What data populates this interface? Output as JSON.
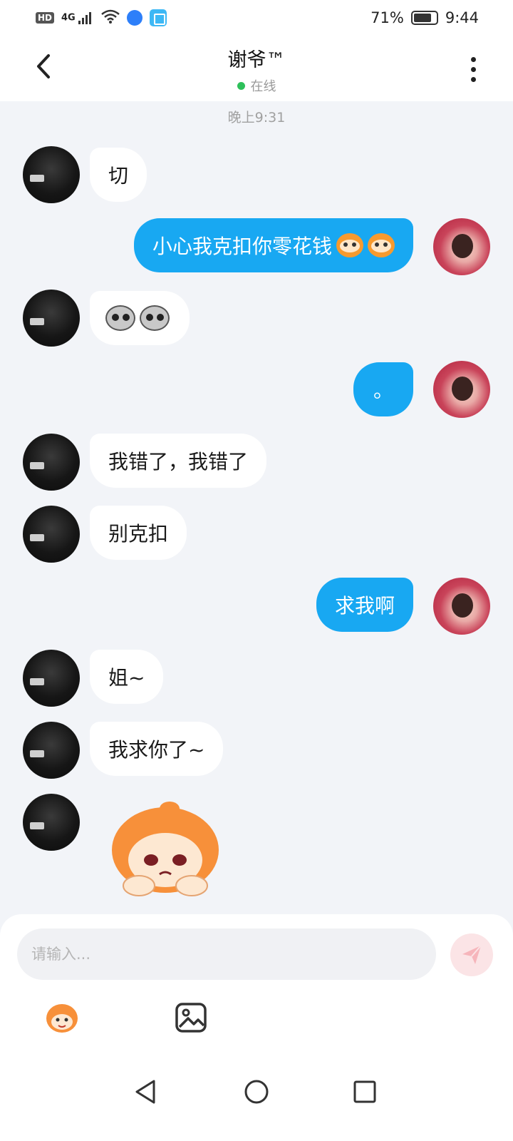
{
  "status_bar": {
    "hd": "HD",
    "network": "4G",
    "battery_percent": "71%",
    "time": "9:44",
    "icons": [
      "hd-icon",
      "signal-icon",
      "wifi-icon",
      "browser-app-icon",
      "reader-app-icon",
      "battery-icon"
    ]
  },
  "header": {
    "title": "谢爷™",
    "presence": "在线",
    "presence_color": "#2ec05a",
    "back_icon": "chevron-left-icon",
    "more_icon": "more-vertical-icon"
  },
  "chat": {
    "timestamp": "晚上9:31",
    "messages": [
      {
        "side": "in",
        "text": "切"
      },
      {
        "side": "out",
        "text": "小心我克扣你零花钱",
        "emojis": [
          "monkey-emoji",
          "monkey-emoji"
        ]
      },
      {
        "side": "in",
        "text": "",
        "emojis": [
          "gray-face-emoji",
          "gray-face-emoji"
        ]
      },
      {
        "side": "out",
        "text": "。"
      },
      {
        "side": "in",
        "text": "我错了，我错了"
      },
      {
        "side": "in",
        "text": "别克扣"
      },
      {
        "side": "out",
        "text": "求我啊"
      },
      {
        "side": "in",
        "text": "姐~"
      },
      {
        "side": "in",
        "text": "我求你了~"
      },
      {
        "side": "in",
        "sticker": "sad-monkey-sticker"
      }
    ],
    "out_bubble_color": "#18a8f2",
    "in_bubble_color": "#ffffff"
  },
  "composer": {
    "placeholder": "请输入...",
    "value": "",
    "send_icon": "send-icon",
    "tools": [
      "emoji-picker-icon",
      "image-picker-icon"
    ]
  },
  "nav": {
    "buttons": [
      "back-triangle-icon",
      "home-circle-icon",
      "recents-square-icon"
    ]
  }
}
